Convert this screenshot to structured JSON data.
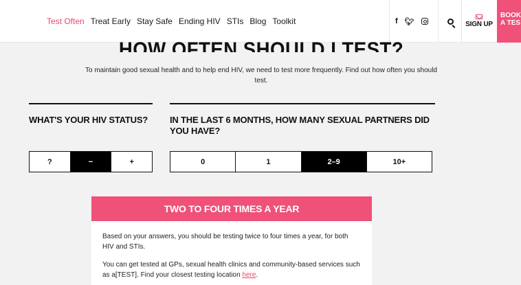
{
  "nav": {
    "items": [
      "Test Often",
      "Treat Early",
      "Stay Safe",
      "Ending HIV",
      "STIs",
      "Blog",
      "Toolkit"
    ],
    "active_index": 0
  },
  "header": {
    "social_icons": [
      "facebook-icon",
      "twitter-icon",
      "instagram-icon"
    ],
    "search_icon": "search-icon",
    "signup_label": "SIGN UP",
    "book_label_line1": "BOOK",
    "book_label_line2": "A TES"
  },
  "hero": {
    "title": "HOW OFTEN SHOULD I TEST?",
    "intro": "To maintain good sexual health and to help end HIV, we need to test more frequently. Find out how often you should test."
  },
  "q1": {
    "title": "WHAT'S YOUR HIV STATUS?",
    "options": [
      "?",
      "−",
      "+"
    ],
    "selected_index": 1
  },
  "q2": {
    "title": "IN THE LAST 6 MONTHS, HOW MANY SEXUAL PARTNERS DID YOU HAVE?",
    "options": [
      "0",
      "1",
      "2–9",
      "10+"
    ],
    "selected_index": 2
  },
  "result": {
    "heading": "TWO TO FOUR TIMES A YEAR",
    "para1": "Based on your answers, you should be testing twice to four times a year, for both HIV and STIs.",
    "para2_text": "You can get tested at GPs, sexual health clinics and community-based services such as a[TEST]. Find your closest testing location ",
    "para2_link": "here",
    "para2_end": "."
  },
  "colors": {
    "accent": "#ef5179",
    "nav_active": "#e8466f",
    "selected": "#000000"
  }
}
